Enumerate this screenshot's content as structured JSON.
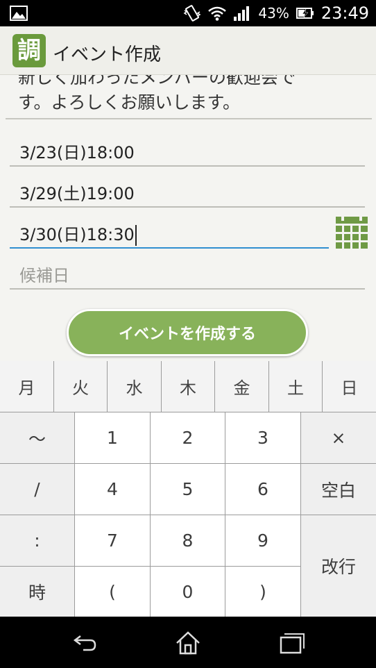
{
  "status_bar": {
    "battery": "43%",
    "time": "23:49",
    "icons": [
      "image-icon",
      "vibrate-icon",
      "wifi-icon",
      "signal-icon",
      "battery-charging-icon"
    ]
  },
  "action_bar": {
    "app_icon_char": "調",
    "title": "イベント作成"
  },
  "form": {
    "description_line1": "新しく加わったメンバーの歓迎会で",
    "description_line2": "す。よろしくお願いします。",
    "dates": [
      "3/23(日)18:00",
      "3/29(土)19:00",
      "3/30(日)18:30"
    ],
    "candidate_placeholder": "候補日",
    "create_button": "イベントを作成する"
  },
  "keyboard": {
    "days": [
      "月",
      "火",
      "水",
      "木",
      "金",
      "土",
      "日"
    ],
    "rows": [
      [
        "〜",
        "1",
        "2",
        "3",
        "×"
      ],
      [
        "/",
        "4",
        "5",
        "6",
        "空白"
      ],
      [
        ":",
        "7",
        "8",
        "9",
        "改行"
      ],
      [
        "時",
        "(",
        "0",
        ")"
      ]
    ]
  },
  "colors": {
    "accent_green": "#88b25a",
    "focus_blue": "#2f8fd0"
  }
}
